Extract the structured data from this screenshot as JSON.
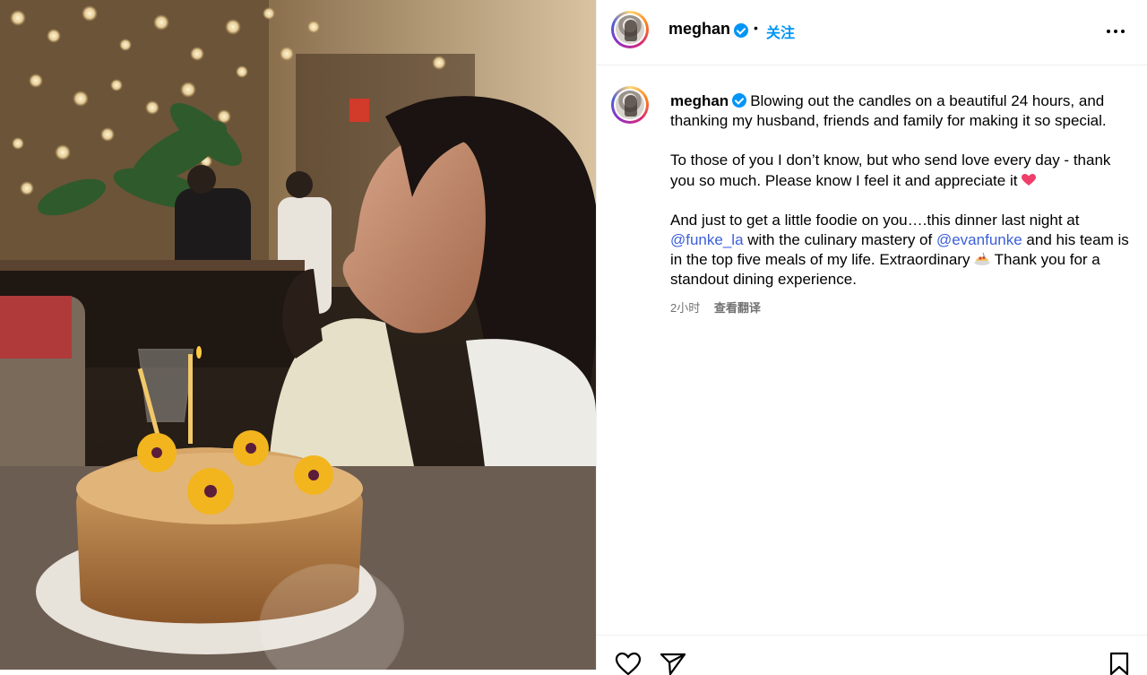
{
  "header": {
    "username": "meghan",
    "separator": "•",
    "follow_label": "关注"
  },
  "caption": {
    "username": "meghan",
    "paragraph_1": "Blowing out the candles on a beautiful 24 hours, and thanking my husband, friends and family for making it so special.",
    "paragraph_2": "To those of you I don’t know, but who send love every day - thank you so much. Please know I feel it and appreciate it",
    "paragraph_3": {
      "part_a": "And just to get a little foodie on you….this dinner last night at",
      "mention_1": "@funke_la",
      "part_b": "with the culinary mastery of",
      "mention_2": "@evanfunke",
      "part_c": "and his team is in the top five meals of my life. Extraordinary",
      "part_d": "Thank you for a standout dining experience."
    },
    "time": "2小时",
    "translate_label": "查看翻译"
  },
  "colors": {
    "accent": "#0095f6",
    "mention": "#3b5fd9",
    "muted": "#737373",
    "divider": "#efefef"
  },
  "icons": [
    "verified-badge-icon",
    "more-options-icon",
    "heart-icon",
    "share-icon",
    "bookmark-icon",
    "heart-emoji-icon",
    "spaghetti-emoji-icon"
  ]
}
